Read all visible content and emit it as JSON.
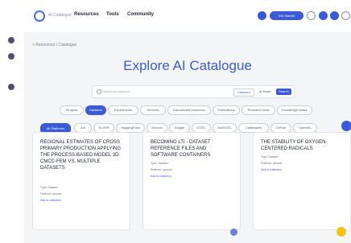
{
  "colors": {
    "accent": "#3b5bd6",
    "rail_icon": "#4a5470",
    "page_bg": "#f4f5f7",
    "chip_active": "#3b5bd6",
    "badge": "#f2c21b"
  },
  "header": {
    "logo_text": "AI Catalogue",
    "nav": [
      "Resources",
      "Tools",
      "Community"
    ],
    "signin_label": "Get Started"
  },
  "breadcrumb": "< Resources / Catalogue",
  "title": "Explore AI Catalogue",
  "search": {
    "placeholder": "Search by keyword",
    "mode_keyword": "Keyword",
    "mode_ai": "AI Mode",
    "button": "Search"
  },
  "type_tabs": [
    "All types",
    "Datasets",
    "Experiments",
    "Services",
    "Educational resources",
    "Publications",
    "Research tools",
    "Knowledge bases"
  ],
  "domain_chips": [
    "All Platforms",
    "AI4",
    "ELIXIR",
    "HuggingFace",
    "Zenodo",
    "Kaggle",
    "EOSC",
    "AI4EOSC",
    "Catalogues",
    "GitHub",
    "OpenML"
  ],
  "cards": [
    {
      "title": "REGIONAL ESTIMATES OF CROSS PRIMARY PRODUCTION APPLYING THE PROCESS-BASED MODEL 3D-CMCC-FEM VS. MULTIPLE DATASETS",
      "type": "Type: Dataset",
      "platform": "Platform: zenodo",
      "link": "Add to collection"
    },
    {
      "title": "BECOMING LTI - DATASET : REFERENCE FILES AND SOFTWARE CONTAINERS",
      "type": "Type: Dataset",
      "platform": "Platform: zenodo",
      "link": "Add to collection"
    },
    {
      "title": "THE STABILITY OF OXYGEN-CENTERED RADICALS",
      "type": "Type: Dataset",
      "platform": "Platform: zenodo",
      "link": "Add to collection"
    }
  ]
}
